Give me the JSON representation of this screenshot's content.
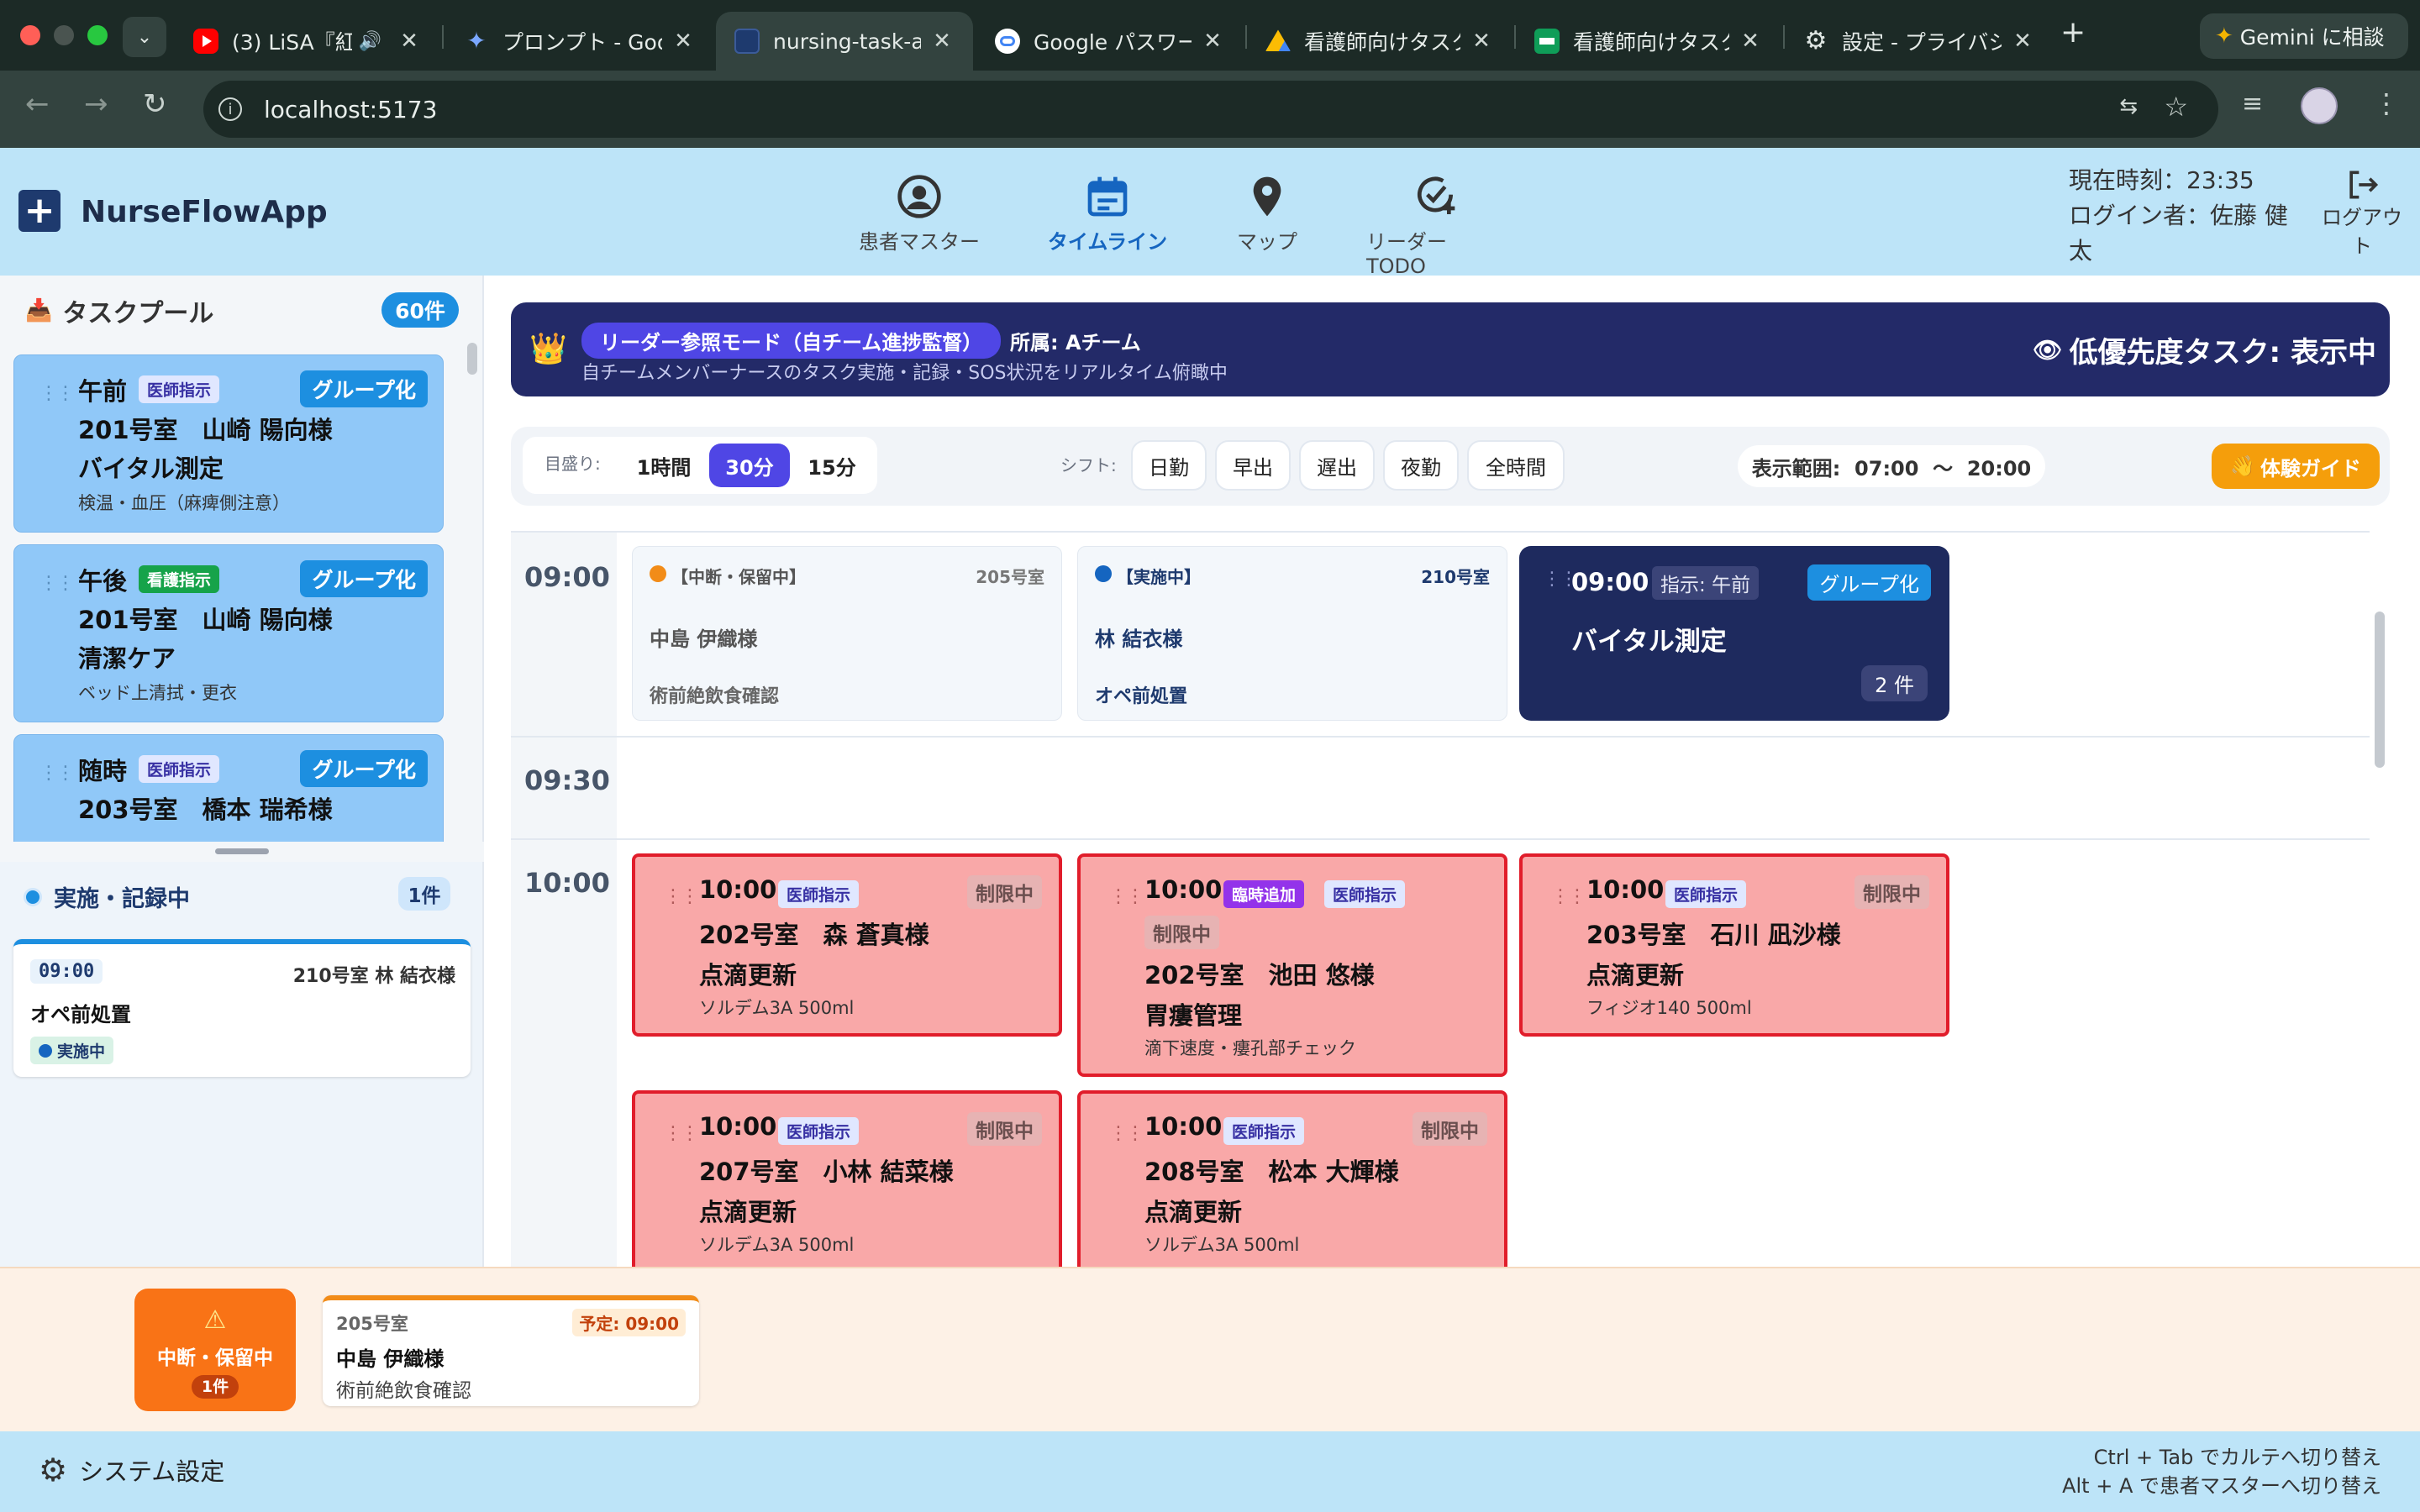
{
  "browser": {
    "tabs": [
      {
        "title": "(3) LiSA『紅",
        "icon": "youtube-icon"
      },
      {
        "title": "プロンプト - Goo",
        "icon": "gemini-icon"
      },
      {
        "title": "nursing-task-ap",
        "icon": "app-icon"
      },
      {
        "title": "Google パスワー",
        "icon": "google-password-icon"
      },
      {
        "title": "看護師向けタスク",
        "icon": "drive-icon"
      },
      {
        "title": "看護師向けタスク",
        "icon": "sheets-icon"
      },
      {
        "title": "設定 - プライバシ",
        "icon": "gear-icon"
      }
    ],
    "gemini_button": "Gemini に相談",
    "url": "localhost:5173"
  },
  "app": {
    "name": "NurseFlowApp",
    "nav": [
      {
        "label": "患者マスター",
        "icon": "user-circle-icon"
      },
      {
        "label": "タイムライン",
        "icon": "calendar-icon"
      },
      {
        "label": "マップ",
        "icon": "map-pin-icon"
      },
      {
        "label": "リーダーTODO",
        "icon": "check-circle-plus-icon"
      }
    ],
    "clock": "現在時刻：23:35",
    "login_line1": "ログイン者：佐藤 健",
    "login_line2": "太",
    "logout_line1": "ログアウ",
    "logout_line2": "ト"
  },
  "sidebar": {
    "pool_title": "タスクプール",
    "pool_count": "60件",
    "pool_cards": [
      {
        "time": "午前",
        "tag": "医師指示",
        "tag_type": "doctor",
        "group": "グループ化",
        "room_patient": "201号室　山崎 陽向様",
        "task": "バイタル測定",
        "note": "検温・血圧（麻痺側注意）"
      },
      {
        "time": "午後",
        "tag": "看護指示",
        "tag_type": "nurse",
        "group": "グループ化",
        "room_patient": "201号室　山崎 陽向様",
        "task": "清潔ケア",
        "note": "ベッド上清拭・更衣"
      },
      {
        "time": "随時",
        "tag": "医師指示",
        "tag_type": "doctor",
        "group": "グループ化",
        "room_patient": "203号室　橋本 瑞希様",
        "task": "",
        "note": ""
      }
    ],
    "inprogress_title": "実施・記録中",
    "inprogress_count": "1件",
    "inprogress_card": {
      "time": "09:00",
      "room_patient": "210号室 林 結衣様",
      "task": "オペ前処置",
      "status": "実施中"
    }
  },
  "banner": {
    "mode": "リーダー参照モード（自チーム進捗監督）",
    "team": "所属: Aチーム",
    "desc": "自チームメンバーナースのタスク実施・記録・SOS状況をリアルタイム俯瞰中",
    "low_priority": "低優先度タスク: 表示中"
  },
  "controls": {
    "scale_label": "目盛り:",
    "scales": [
      "1時間",
      "30分",
      "15分"
    ],
    "active_scale": "30分",
    "shift_label": "シフト:",
    "shifts": [
      "日勤",
      "早出",
      "遅出",
      "夜勤",
      "全時間"
    ],
    "range": "表示範囲:  07:00  〜  20:00",
    "guide": "体験ガイド"
  },
  "timeline": {
    "slots": [
      "09:00",
      "09:30",
      "10:00"
    ],
    "row0": [
      {
        "status": "【中断・保留中】",
        "room": "205号室",
        "patient": "中島 伊織様",
        "task": "術前絶飲食確認",
        "dot": "#f28c18"
      },
      {
        "status": "【実施中】",
        "room": "210号室",
        "patient": "林 結衣様",
        "task": "オペ前処置",
        "dot": "#1565c0"
      }
    ],
    "group_card": {
      "time": "09:00",
      "instr": "指示: 午前",
      "group": "グループ化",
      "task": "バイタル測定",
      "count": "2 件"
    },
    "red_cards": [
      {
        "time": "10:00",
        "tags": [
          "医師指示"
        ],
        "limit": "制限中",
        "room_patient": "202号室　森 蒼真様",
        "task": "点滴更新",
        "note": "ソルデム3A 500ml"
      },
      {
        "time": "10:00",
        "tags": [
          "臨時追加",
          "医師指示"
        ],
        "limit": "制限中",
        "room_patient": "202号室　池田 悠様",
        "task": "胃瘻管理",
        "note": "滴下速度・瘻孔部チェック"
      },
      {
        "time": "10:00",
        "tags": [
          "医師指示"
        ],
        "limit": "制限中",
        "room_patient": "203号室　石川 凪沙様",
        "task": "点滴更新",
        "note": "フィジオ140 500ml"
      },
      {
        "time": "10:00",
        "tags": [
          "医師指示"
        ],
        "limit": "制限中",
        "room_patient": "207号室　小林 結菜様",
        "task": "点滴更新",
        "note": "ソルデム3A 500ml"
      },
      {
        "time": "10:00",
        "tags": [
          "医師指示"
        ],
        "limit": "制限中",
        "room_patient": "208号室　松本 大輝様",
        "task": "点滴更新",
        "note": "ソルデム3A 500ml"
      }
    ]
  },
  "hold": {
    "label": "中断・保留中",
    "count": "1件",
    "card": {
      "room": "205号室",
      "scheduled": "予定: 09:00",
      "patient": "中島 伊織様",
      "task": "術前絶飲食確認"
    }
  },
  "footer": {
    "settings": "システム設定",
    "hint1": "Ctrl + Tab でカルテへ切り替え",
    "hint2": "Alt + A で患者マスターへ切り替え"
  }
}
